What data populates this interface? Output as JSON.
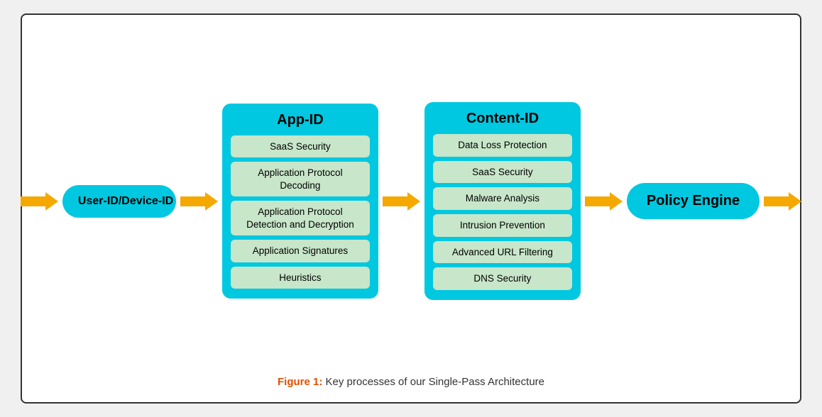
{
  "diagram": {
    "title": "",
    "user_id_label": "User-ID/Device-ID",
    "app_id": {
      "title": "App-ID",
      "items": [
        "SaaS Security",
        "Application Protocol Decoding",
        "Application Protocol Detection and Decryption",
        "Application Signatures",
        "Heuristics"
      ]
    },
    "content_id": {
      "title": "Content-ID",
      "items": [
        "Data Loss Protection",
        "SaaS Security",
        "Malware Analysis",
        "Intrusion Prevention",
        "Advanced URL Filtering",
        "DNS Security"
      ]
    },
    "policy_engine_label": "Policy Engine",
    "figure_caption_bold": "Figure 1:",
    "figure_caption_text": " Key processes of our Single-Pass Architecture"
  }
}
